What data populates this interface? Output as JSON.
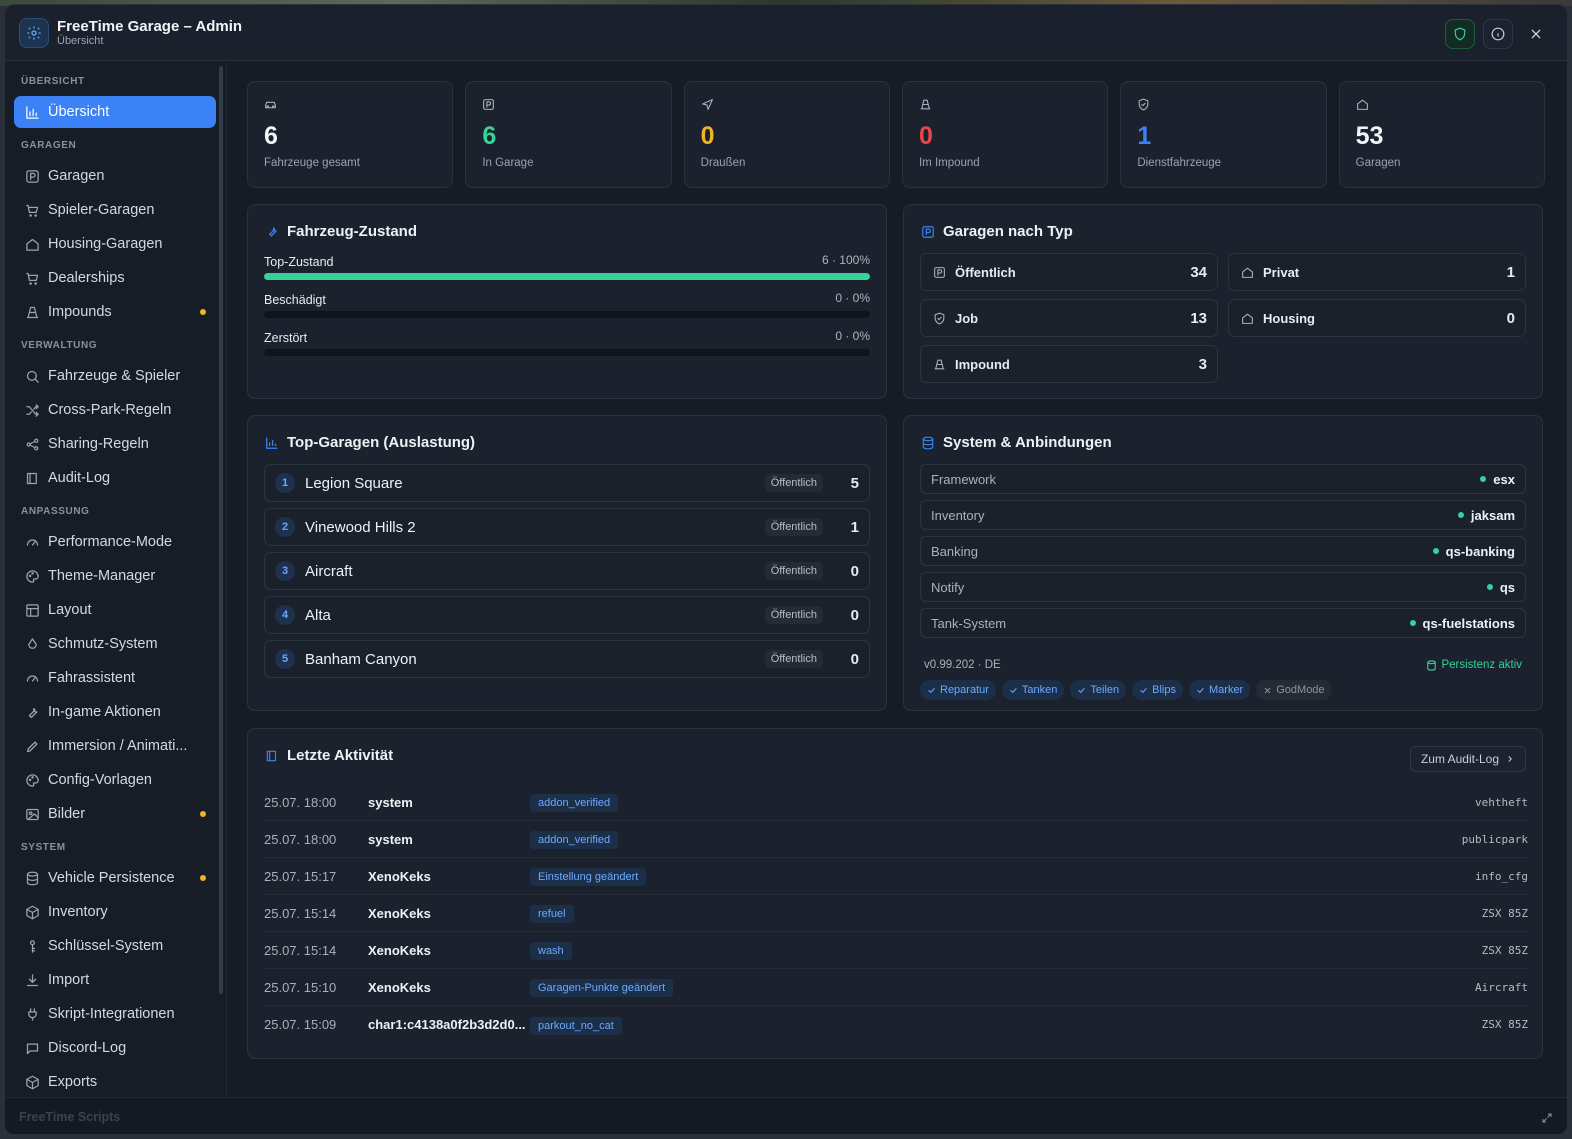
{
  "app": {
    "title": "FreeTime Garage – Admin",
    "subtitle": "Übersicht",
    "footer": "FreeTime Scripts"
  },
  "sidebar": {
    "sections": [
      {
        "title": "ÜBERSICHT",
        "items": [
          {
            "label": "Übersicht",
            "icon": "bar-chart-icon",
            "active": true
          }
        ]
      },
      {
        "title": "GARAGEN",
        "items": [
          {
            "label": "Garagen",
            "icon": "parking-icon"
          },
          {
            "label": "Spieler-Garagen",
            "icon": "cart-icon"
          },
          {
            "label": "Housing-Garagen",
            "icon": "home-icon"
          },
          {
            "label": "Dealerships",
            "icon": "cart-icon"
          },
          {
            "label": "Impounds",
            "icon": "cone-icon",
            "dot": true
          }
        ]
      },
      {
        "title": "VERWALTUNG",
        "items": [
          {
            "label": "Fahrzeuge & Spieler",
            "icon": "search-icon"
          },
          {
            "label": "Cross-Park-Regeln",
            "icon": "shuffle-icon"
          },
          {
            "label": "Sharing-Regeln",
            "icon": "share-icon"
          },
          {
            "label": "Audit-Log",
            "icon": "log-icon"
          }
        ]
      },
      {
        "title": "ANPASSUNG",
        "items": [
          {
            "label": "Performance-Mode",
            "icon": "gauge-icon"
          },
          {
            "label": "Theme-Manager",
            "icon": "palette-icon"
          },
          {
            "label": "Layout",
            "icon": "layout-icon"
          },
          {
            "label": "Schmutz-System",
            "icon": "drop-icon"
          },
          {
            "label": "Fahrassistent",
            "icon": "gauge-icon"
          },
          {
            "label": "In-game Aktionen",
            "icon": "wrench-icon"
          },
          {
            "label": "Immersion / Animati...",
            "icon": "pen-icon"
          },
          {
            "label": "Config-Vorlagen",
            "icon": "palette-icon"
          },
          {
            "label": "Bilder",
            "icon": "image-icon",
            "dot": true
          }
        ]
      },
      {
        "title": "SYSTEM",
        "items": [
          {
            "label": "Vehicle Persistence",
            "icon": "database-icon",
            "dot": true
          },
          {
            "label": "Inventory",
            "icon": "box-icon"
          },
          {
            "label": "Schlüssel-System",
            "icon": "key-icon"
          },
          {
            "label": "Import",
            "icon": "download-icon"
          },
          {
            "label": "Skript-Integrationen",
            "icon": "plug-icon"
          },
          {
            "label": "Discord-Log",
            "icon": "chat-icon"
          },
          {
            "label": "Exports",
            "icon": "box-icon"
          }
        ]
      }
    ]
  },
  "stats": [
    {
      "icon": "car-icon",
      "value": "6",
      "label": "Fahrzeuge gesamt",
      "color": "#f1f4f8"
    },
    {
      "icon": "parking-icon",
      "value": "6",
      "label": "In Garage",
      "color": "#34d399"
    },
    {
      "icon": "send-icon",
      "value": "0",
      "label": "Draußen",
      "color": "#f0b429"
    },
    {
      "icon": "cone-icon",
      "value": "0",
      "label": "Im Impound",
      "color": "#ef4444"
    },
    {
      "icon": "shield-icon",
      "value": "1",
      "label": "Dienstfahrzeuge",
      "color": "#3b82f6"
    },
    {
      "icon": "home-icon",
      "value": "53",
      "label": "Garagen",
      "color": "#f1f4f8"
    }
  ],
  "condition": {
    "title": "Fahrzeug-Zustand",
    "rows": [
      {
        "label": "Top-Zustand",
        "value": "6 · 100%",
        "fraction": 1.0
      },
      {
        "label": "Beschädigt",
        "value": "0 · 0%",
        "fraction": 0
      },
      {
        "label": "Zerstört",
        "value": "0 · 0%",
        "fraction": 0
      }
    ]
  },
  "garage_types": {
    "title": "Garagen nach Typ",
    "items": [
      {
        "label": "Öffentlich",
        "count": "34",
        "icon": "parking-icon"
      },
      {
        "label": "Privat",
        "count": "1",
        "icon": "home-icon"
      },
      {
        "label": "Job",
        "count": "13",
        "icon": "shield-icon"
      },
      {
        "label": "Housing",
        "count": "0",
        "icon": "home-icon"
      },
      {
        "label": "Impound",
        "count": "3",
        "icon": "cone-icon"
      }
    ]
  },
  "top_garages": {
    "title": "Top-Garagen (Auslastung)",
    "rows": [
      {
        "rank": "1",
        "name": "Legion Square",
        "type": "Öffentlich",
        "count": "5"
      },
      {
        "rank": "2",
        "name": "Vinewood Hills 2",
        "type": "Öffentlich",
        "count": "1"
      },
      {
        "rank": "3",
        "name": "Aircraft",
        "type": "Öffentlich",
        "count": "0"
      },
      {
        "rank": "4",
        "name": "Alta",
        "type": "Öffentlich",
        "count": "0"
      },
      {
        "rank": "5",
        "name": "Banham Canyon",
        "type": "Öffentlich",
        "count": "0"
      }
    ]
  },
  "system": {
    "title": "System & Anbindungen",
    "rows": [
      {
        "label": "Framework",
        "value": "esx"
      },
      {
        "label": "Inventory",
        "value": "jaksam"
      },
      {
        "label": "Banking",
        "value": "qs-banking"
      },
      {
        "label": "Notify",
        "value": "qs"
      },
      {
        "label": "Tank-System",
        "value": "qs-fuelstations"
      }
    ],
    "version": "v0.99.202 · DE",
    "persistence": "Persistenz aktiv",
    "chips": [
      {
        "label": "Reparatur",
        "on": true
      },
      {
        "label": "Tanken",
        "on": true
      },
      {
        "label": "Teilen",
        "on": true
      },
      {
        "label": "Blips",
        "on": true
      },
      {
        "label": "Marker",
        "on": true
      },
      {
        "label": "GodMode",
        "on": false
      }
    ]
  },
  "activity": {
    "title": "Letzte Aktivität",
    "button": "Zum Audit-Log",
    "rows": [
      {
        "time": "25.07. 18:00",
        "user": "system",
        "action": "addon_verified",
        "target": "vehtheft"
      },
      {
        "time": "25.07. 18:00",
        "user": "system",
        "action": "addon_verified",
        "target": "publicpark"
      },
      {
        "time": "25.07. 15:17",
        "user": "XenoKeks",
        "action": "Einstellung geändert",
        "target": "info_cfg"
      },
      {
        "time": "25.07. 15:14",
        "user": "XenoKeks",
        "action": "refuel",
        "target": "ZSX 85Z"
      },
      {
        "time": "25.07. 15:14",
        "user": "XenoKeks",
        "action": "wash",
        "target": "ZSX 85Z"
      },
      {
        "time": "25.07. 15:10",
        "user": "XenoKeks",
        "action": "Garagen-Punkte geändert",
        "target": "Aircraft"
      },
      {
        "time": "25.07. 15:09",
        "user": "char1:c4138a0f2b3d2d0...",
        "action": "parkout_no_cat",
        "target": "ZSX 85Z"
      }
    ]
  }
}
